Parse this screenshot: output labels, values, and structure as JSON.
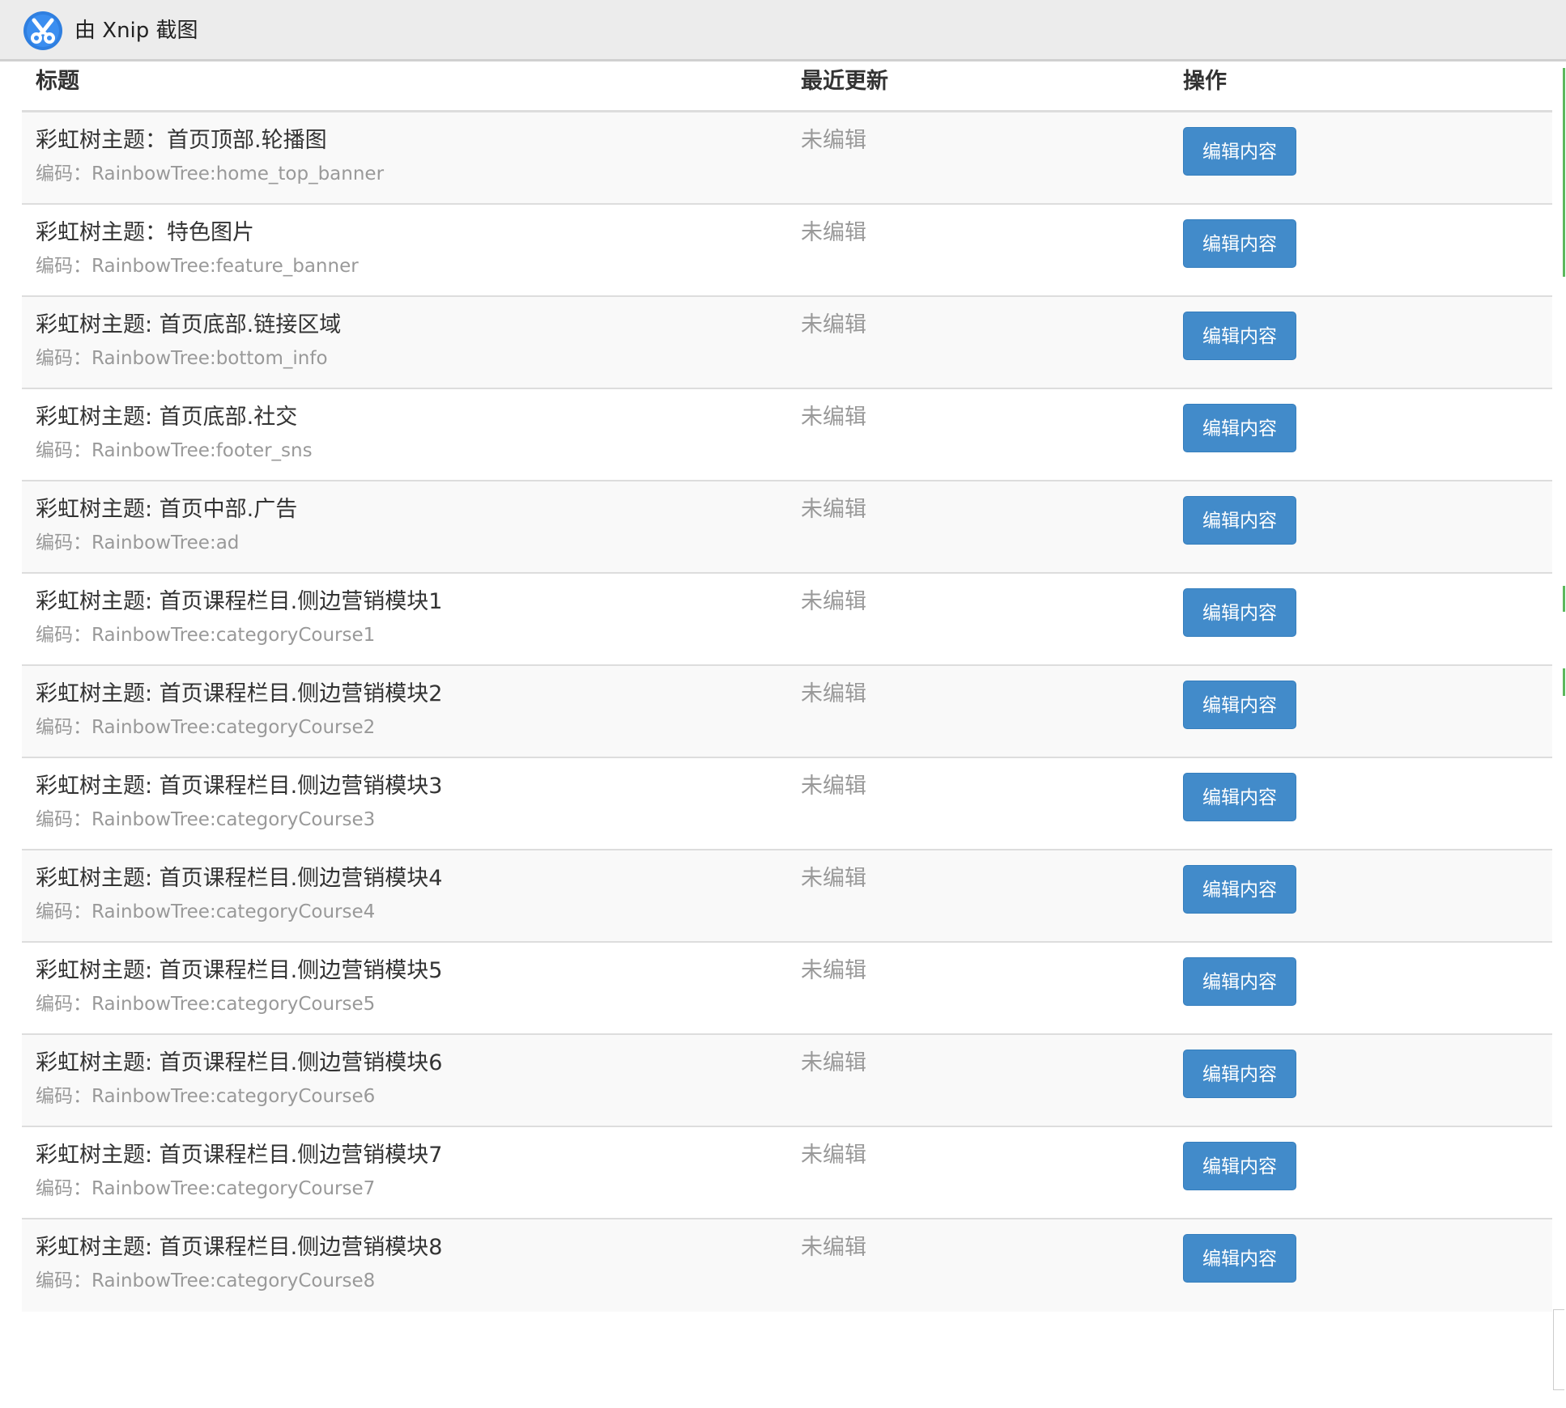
{
  "titlebar": {
    "app_icon": "xnip-scissors-icon",
    "title": "由 Xnip 截图"
  },
  "table": {
    "headers": {
      "title": "标题",
      "updated": "最近更新",
      "action": "操作"
    },
    "rows": [
      {
        "title": "彩虹树主题：首页顶部.轮播图",
        "code": "编码：RainbowTree:home_top_banner",
        "status": "未编辑",
        "button": "编辑内容"
      },
      {
        "title": "彩虹树主题：特色图片",
        "code": "编码：RainbowTree:feature_banner",
        "status": "未编辑",
        "button": "编辑内容"
      },
      {
        "title": "彩虹树主题: 首页底部.链接区域",
        "code": "编码：RainbowTree:bottom_info",
        "status": "未编辑",
        "button": "编辑内容"
      },
      {
        "title": "彩虹树主题: 首页底部.社交",
        "code": "编码：RainbowTree:footer_sns",
        "status": "未编辑",
        "button": "编辑内容"
      },
      {
        "title": "彩虹树主题: 首页中部.广告",
        "code": "编码：RainbowTree:ad",
        "status": "未编辑",
        "button": "编辑内容"
      },
      {
        "title": "彩虹树主题: 首页课程栏目.侧边营销模块1",
        "code": "编码：RainbowTree:categoryCourse1",
        "status": "未编辑",
        "button": "编辑内容"
      },
      {
        "title": "彩虹树主题: 首页课程栏目.侧边营销模块2",
        "code": "编码：RainbowTree:categoryCourse2",
        "status": "未编辑",
        "button": "编辑内容"
      },
      {
        "title": "彩虹树主题: 首页课程栏目.侧边营销模块3",
        "code": "编码：RainbowTree:categoryCourse3",
        "status": "未编辑",
        "button": "编辑内容"
      },
      {
        "title": "彩虹树主题: 首页课程栏目.侧边营销模块4",
        "code": "编码：RainbowTree:categoryCourse4",
        "status": "未编辑",
        "button": "编辑内容"
      },
      {
        "title": "彩虹树主题: 首页课程栏目.侧边营销模块5",
        "code": "编码：RainbowTree:categoryCourse5",
        "status": "未编辑",
        "button": "编辑内容"
      },
      {
        "title": "彩虹树主题: 首页课程栏目.侧边营销模块6",
        "code": "编码：RainbowTree:categoryCourse6",
        "status": "未编辑",
        "button": "编辑内容"
      },
      {
        "title": "彩虹树主题: 首页课程栏目.侧边营销模块7",
        "code": "编码：RainbowTree:categoryCourse7",
        "status": "未编辑",
        "button": "编辑内容"
      },
      {
        "title": "彩虹树主题: 首页课程栏目.侧边营销模块8",
        "code": "编码：RainbowTree:categoryCourse8",
        "status": "未编辑",
        "button": "编辑内容"
      }
    ]
  },
  "colors": {
    "button_bg": "#428bca",
    "status_text": "#999999",
    "stripe_bg": "#f9f9f9",
    "accent_edge": "#5cb85c"
  }
}
